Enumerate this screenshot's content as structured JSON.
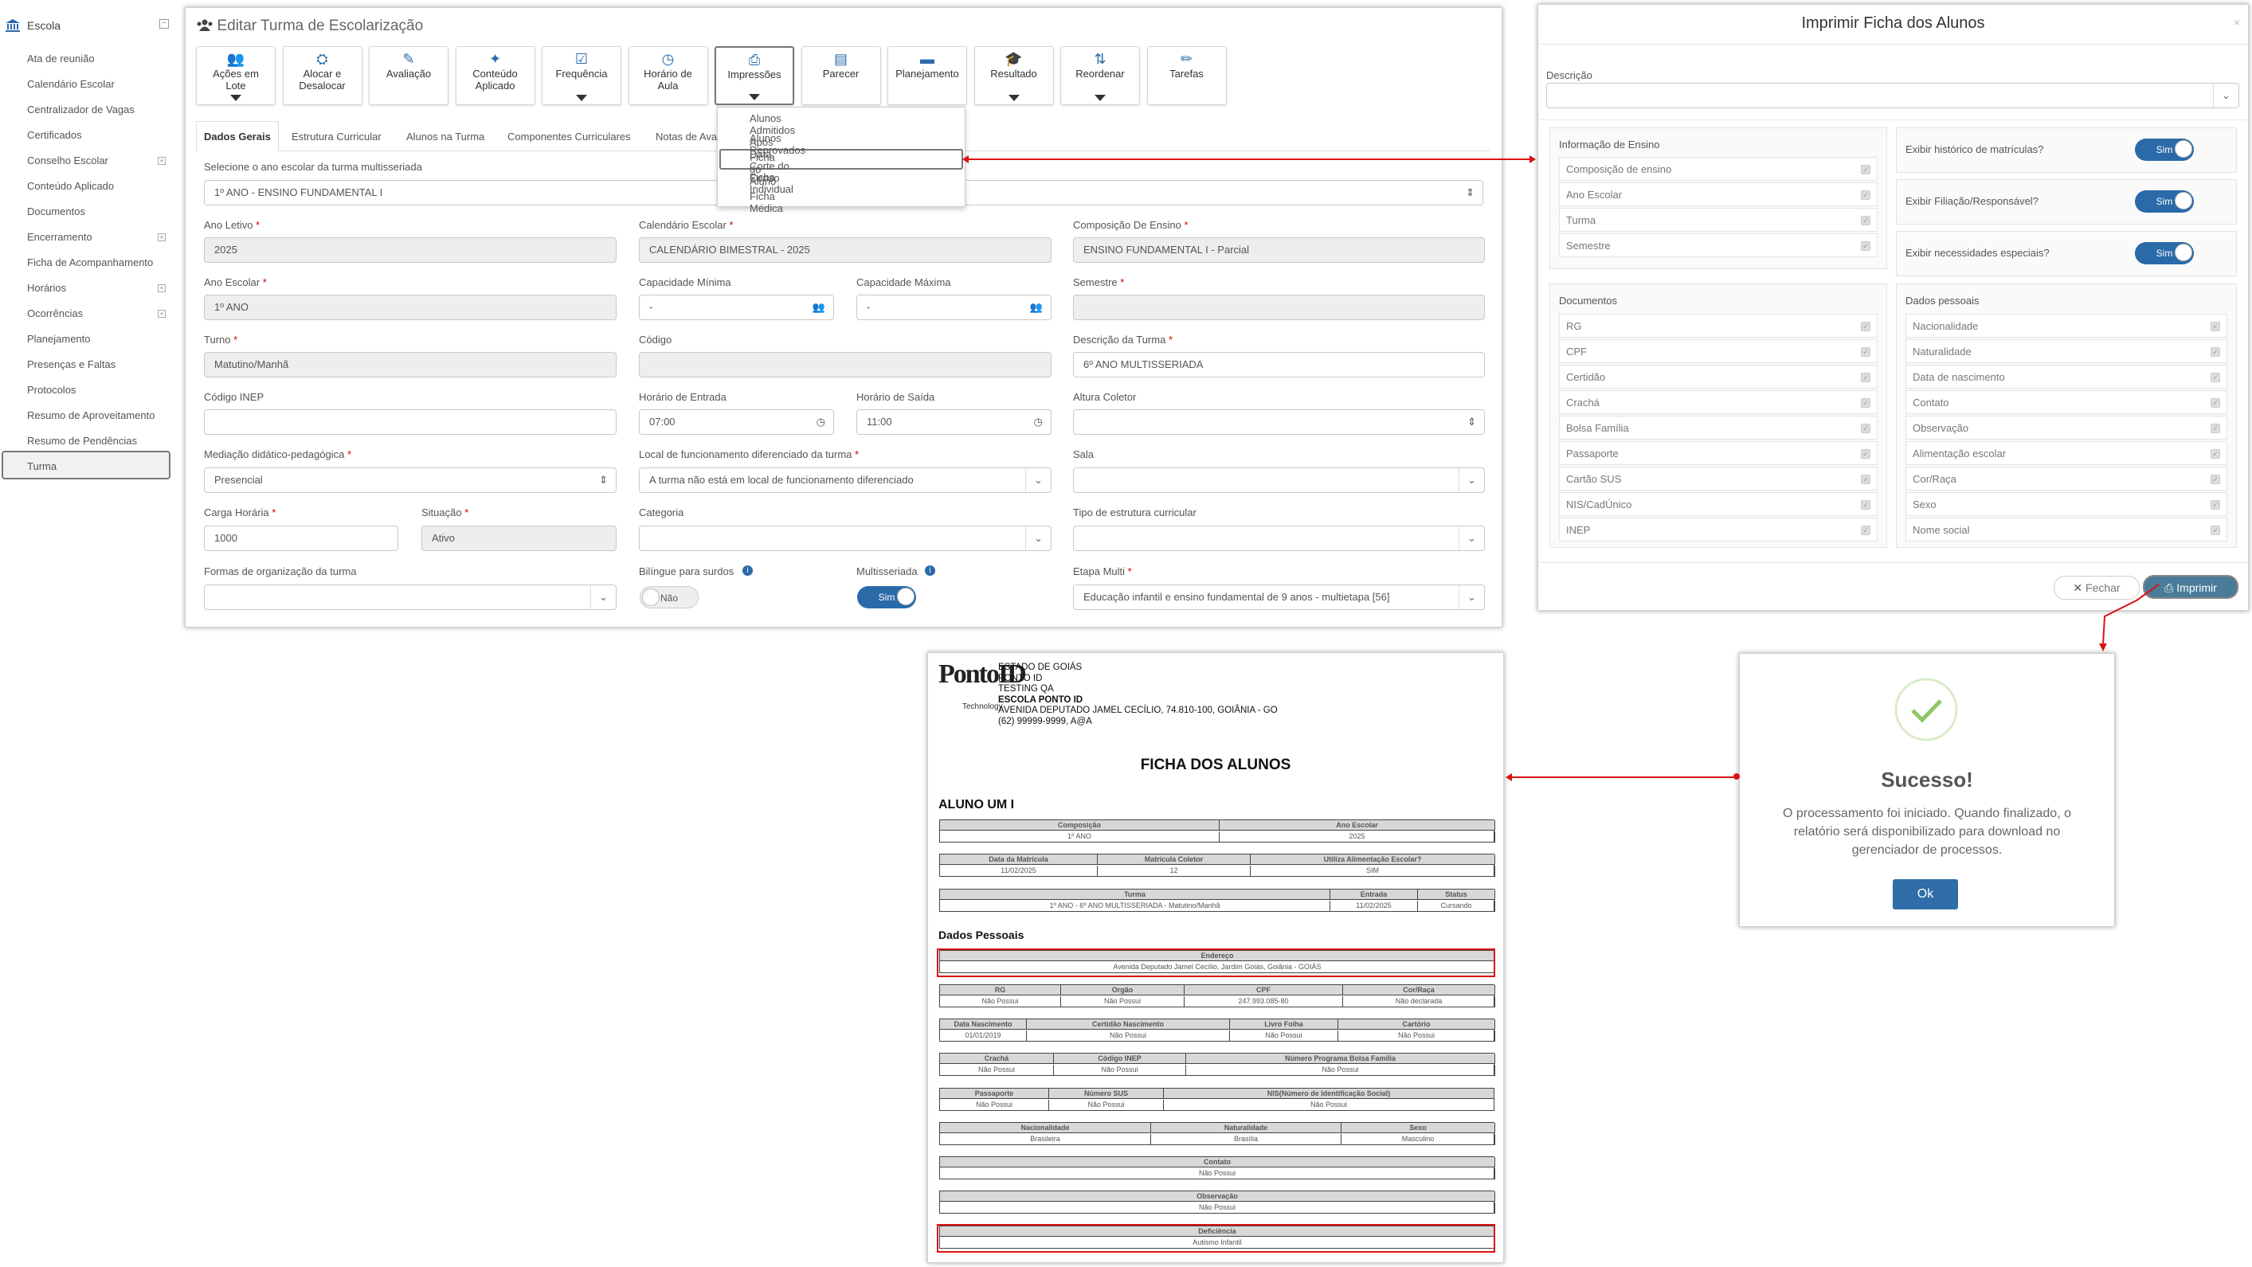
{
  "sidebar": {
    "header": "Escola",
    "items": [
      {
        "label": "Ata de reunião",
        "expand": false
      },
      {
        "label": "Calendário Escolar",
        "expand": false
      },
      {
        "label": "Centralizador de Vagas",
        "expand": false
      },
      {
        "label": "Certificados",
        "expand": false
      },
      {
        "label": "Conselho Escolar",
        "expand": true
      },
      {
        "label": "Conteúdo Aplicado",
        "expand": false
      },
      {
        "label": "Documentos",
        "expand": false
      },
      {
        "label": "Encerramento",
        "expand": true
      },
      {
        "label": "Ficha de Acompanhamento",
        "expand": false
      },
      {
        "label": "Horários",
        "expand": true
      },
      {
        "label": "Ocorrências",
        "expand": true
      },
      {
        "label": "Planejamento",
        "expand": false
      },
      {
        "label": "Presenças e Faltas",
        "expand": false
      },
      {
        "label": "Protocolos",
        "expand": false
      },
      {
        "label": "Resumo de Aproveitamento",
        "expand": false
      },
      {
        "label": "Resumo de Pendências",
        "expand": false
      },
      {
        "label": "Turma",
        "expand": false
      }
    ]
  },
  "main": {
    "title": "Editar Turma de Escolarização",
    "toolbar": [
      {
        "label": "Ações em\nLote",
        "icon": "users-icon",
        "dropdown": true
      },
      {
        "label": "Alocar e\nDesalocar",
        "icon": "sitemap-icon",
        "dropdown": false
      },
      {
        "label": "Avaliação",
        "icon": "edit-icon",
        "dropdown": false
      },
      {
        "label": "Conteúdo\nAplicado",
        "icon": "wand-icon",
        "dropdown": false
      },
      {
        "label": "Frequência",
        "icon": "check-square-icon",
        "dropdown": true
      },
      {
        "label": "Horário de\nAula",
        "icon": "clock-icon",
        "dropdown": false
      },
      {
        "label": "Impressões",
        "icon": "print-icon",
        "dropdown": true
      },
      {
        "label": "Parecer",
        "icon": "file-icon",
        "dropdown": false
      },
      {
        "label": "Planejamento",
        "icon": "book-icon",
        "dropdown": false
      },
      {
        "label": "Resultado",
        "icon": "graduation-cap-icon",
        "dropdown": true
      },
      {
        "label": "Reordenar",
        "icon": "sort-alpha-icon",
        "dropdown": true
      },
      {
        "label": "Tarefas",
        "icon": "pencil-icon",
        "dropdown": false
      }
    ],
    "print_menu": [
      "Alunos Admitidos Após Data Corte do Censo",
      "Alunos Reprovados",
      "Ficha do Aluno",
      "Ficha Individual",
      "Ficha Médica"
    ],
    "tabs": [
      "Dados Gerais",
      "Estrutura Curricular",
      "Alunos na Turma",
      "Componentes Curriculares",
      "Notas de Ava",
      "a"
    ],
    "fields": {
      "ano_multi_label": "Selecione o ano escolar da turma multisseriada",
      "ano_multi_value": "1º ANO - ENSINO FUNDAMENTAL I",
      "ano_letivo_label": "Ano Letivo",
      "ano_letivo": "2025",
      "calendario_label": "Calendário Escolar",
      "calendario": "CALENDÁRIO BIMESTRAL - 2025",
      "composicao_label": "Composição De Ensino",
      "composicao": "ENSINO FUNDAMENTAL I - Parcial",
      "ano_escolar_label": "Ano Escolar",
      "ano_escolar": "1º ANO",
      "cap_min_label": "Capacidade Mínima",
      "cap_min": "-",
      "cap_max_label": "Capacidade Máxima",
      "cap_max": "-",
      "semestre_label": "Semestre",
      "semestre": "",
      "turno_label": "Turno",
      "turno": "Matutino/Manhã",
      "codigo_label": "Código",
      "codigo": "",
      "descricao_label": "Descrição da Turma",
      "descricao": "6º ANO MULTISSERIADA",
      "inep_label": "Código INEP",
      "inep": "",
      "entrada_label": "Horário de Entrada",
      "entrada": "07:00",
      "saida_label": "Horário de Saída",
      "saida": "11:00",
      "altura_label": "Altura Coletor",
      "altura": "",
      "mediacao_label": "Mediação didático-pedagógica",
      "mediacao": "Presencial",
      "local_label": "Local de funcionamento diferenciado da turma",
      "local": "A turma não está em local de funcionamento diferenciado",
      "sala_label": "Sala",
      "sala": "",
      "carga_label": "Carga Horária",
      "carga": "1000",
      "situacao_label": "Situação",
      "situacao": "Ativo",
      "categoria_label": "Categoria",
      "categoria": "",
      "tipo_label": "Tipo de estrutura curricular",
      "tipo": "",
      "formas_label": "Formas de organização da turma",
      "formas": "",
      "bilingue_label": "Bilíngue para surdos",
      "bilingue": "Não",
      "multisseriada_label": "Multisseriada",
      "multisseriada": "Sim",
      "etapa_label": "Etapa Multi",
      "etapa": "Educação infantil e ensino fundamental de 9 anos - multietapa [56]"
    }
  },
  "modal": {
    "title": "Imprimir Ficha dos Alunos",
    "descricao_label": "Descrição",
    "info_title": "Informação de Ensino",
    "info_items": [
      "Composição de ensino",
      "Ano Escolar",
      "Turma",
      "Semestre"
    ],
    "questions": [
      {
        "label": "Exibir histórico de matrículas?",
        "value": "Sim"
      },
      {
        "label": "Exibir Filiação/Responsável?",
        "value": "Sim"
      },
      {
        "label": "Exibir necessidades especiais?",
        "value": "Sim"
      }
    ],
    "docs_title": "Documentos",
    "docs": [
      "RG",
      "CPF",
      "Certidão",
      "Crachá",
      "Bolsa Família",
      "Passaporte",
      "Cartão SUS",
      "NIS/CadÚnico",
      "INEP"
    ],
    "pessoais_title": "Dados pessoais",
    "pessoais": [
      "Nacionalidade",
      "Naturalidade",
      "Data de nascimento",
      "Contato",
      "Observação",
      "Alimentação escolar",
      "Cor/Raça",
      "Sexo",
      "Nome social"
    ],
    "close_label": "Fechar",
    "print_label": "Imprimir"
  },
  "success": {
    "title": "Sucesso!",
    "message": "O processamento foi iniciado. Quando finalizado, o relatório será disponibilizado para download no gerenciador de processos.",
    "ok_label": "Ok"
  },
  "report": {
    "logo_text": "PontoID",
    "logo_sub": "Technology",
    "header_lines": [
      "ESTADO DE GOIÁS",
      "PONTO ID",
      "TESTING QA",
      "ESCOLA PONTO ID",
      "AVENIDA DEPUTADO JAMEL CECÍLIO, 74.810-100, GOIÂNIA - GO",
      "(62) 99999-9999, A@A"
    ],
    "title": "FICHA DOS ALUNOS",
    "student": "ALUNO UM I",
    "section": "Dados Pessoais",
    "tables": [
      {
        "cols": [
          "Composição",
          "Ano Escolar"
        ],
        "vals": [
          "1º ANO",
          "2025"
        ]
      },
      {
        "cols": [
          "Data da Matrícula",
          "Matrícula Coletor",
          "Utiliza Alimentação Escolar?"
        ],
        "vals": [
          "11/02/2025",
          "12",
          "SIM"
        ]
      },
      {
        "cols": [
          "Turma",
          "Entrada",
          "Status"
        ],
        "vals": [
          "1º ANO - 6º ANO MULTISSERIADA - Matutino/Manhã",
          "11/02/2025",
          "Cursando"
        ]
      },
      {
        "cols": [
          "Endereço"
        ],
        "vals": [
          "Avenida Deputado Jamel Cecílio, Jardim Goiás, Goiânia - GOIÁS"
        ]
      },
      {
        "cols": [
          "RG",
          "Orgão",
          "CPF",
          "Cor/Raça"
        ],
        "vals": [
          "Não Possui",
          "Não Possui",
          "247.993.085-80",
          "Não declarada"
        ]
      },
      {
        "cols": [
          "Data Nascimento",
          "Certidão Nascimento",
          "Livro Folha",
          "Cartório"
        ],
        "vals": [
          "01/01/2019",
          "Não Possui",
          "Não Possui",
          "Não Possui"
        ]
      },
      {
        "cols": [
          "Crachá",
          "Código INEP",
          "Número Programa Bolsa Família"
        ],
        "vals": [
          "Não Possui",
          "Não Possui",
          "Não Possui"
        ]
      },
      {
        "cols": [
          "Passaporte",
          "Número SUS",
          "NIS(Número de Identificação Social)"
        ],
        "vals": [
          "Não Possui",
          "Não Possui",
          "Não Possui"
        ]
      },
      {
        "cols": [
          "Nacionalidade",
          "Naturalidade",
          "Sexo"
        ],
        "vals": [
          "Brasileira",
          "Brasília",
          "Masculino"
        ]
      },
      {
        "cols": [
          "Contato"
        ],
        "vals": [
          "Não Possui"
        ]
      },
      {
        "cols": [
          "Observação"
        ],
        "vals": [
          "Não Possui"
        ]
      },
      {
        "cols": [
          "Deficiência"
        ],
        "vals": [
          "Autismo Infantil"
        ]
      }
    ]
  },
  "colors": {
    "accent": "#2a6aa8",
    "highlight": "#d11111",
    "success": "#8cc963"
  }
}
